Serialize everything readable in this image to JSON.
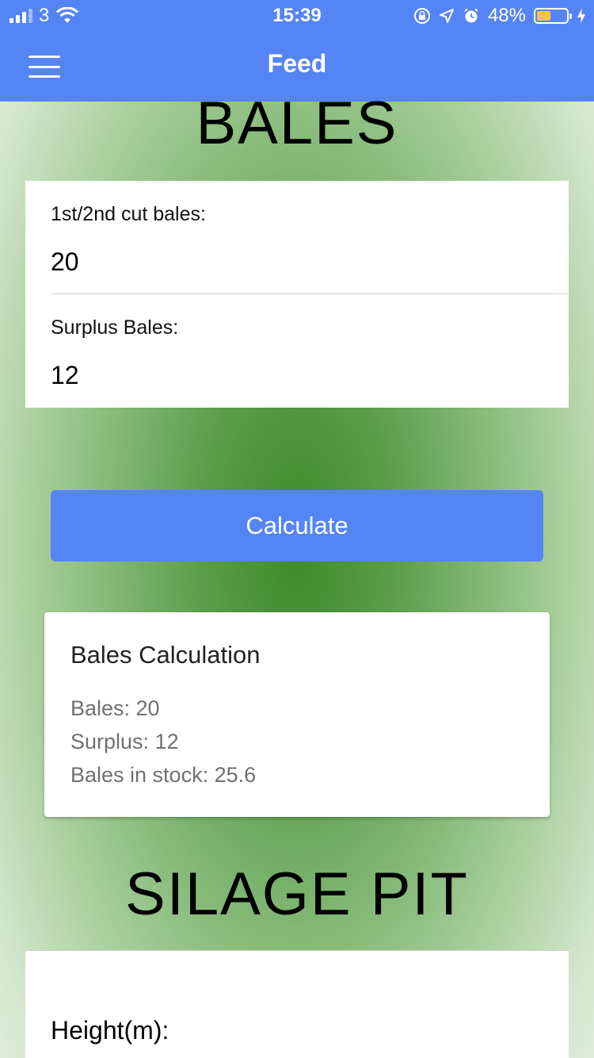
{
  "status_bar": {
    "carrier": "3",
    "time": "15:39",
    "battery": "48%",
    "battery_level": 0.48,
    "icons": [
      "signal-icon",
      "wifi-icon",
      "rotation-lock-icon",
      "location-icon",
      "alarm-icon",
      "battery-icon",
      "charging-icon"
    ]
  },
  "header": {
    "title": "Feed",
    "menu_icon": "hamburger-menu-icon"
  },
  "bales": {
    "section_title": "BALES",
    "fields": [
      {
        "label": "1st/2nd cut bales:",
        "value": "20"
      },
      {
        "label": "Surplus Bales:",
        "value": "12"
      }
    ],
    "button_label": "Calculate",
    "result": {
      "title": "Bales Calculation",
      "lines": [
        "Bales: 20",
        "Surplus: 12",
        "Bales in stock: 25.6"
      ]
    }
  },
  "silage": {
    "section_title": "SILAGE PIT",
    "fields": [
      {
        "label": "Height(m):"
      }
    ]
  },
  "colors": {
    "accent": "#5585f4",
    "battery_fill": "#f7c739",
    "background_green": "#3d8a2c"
  }
}
